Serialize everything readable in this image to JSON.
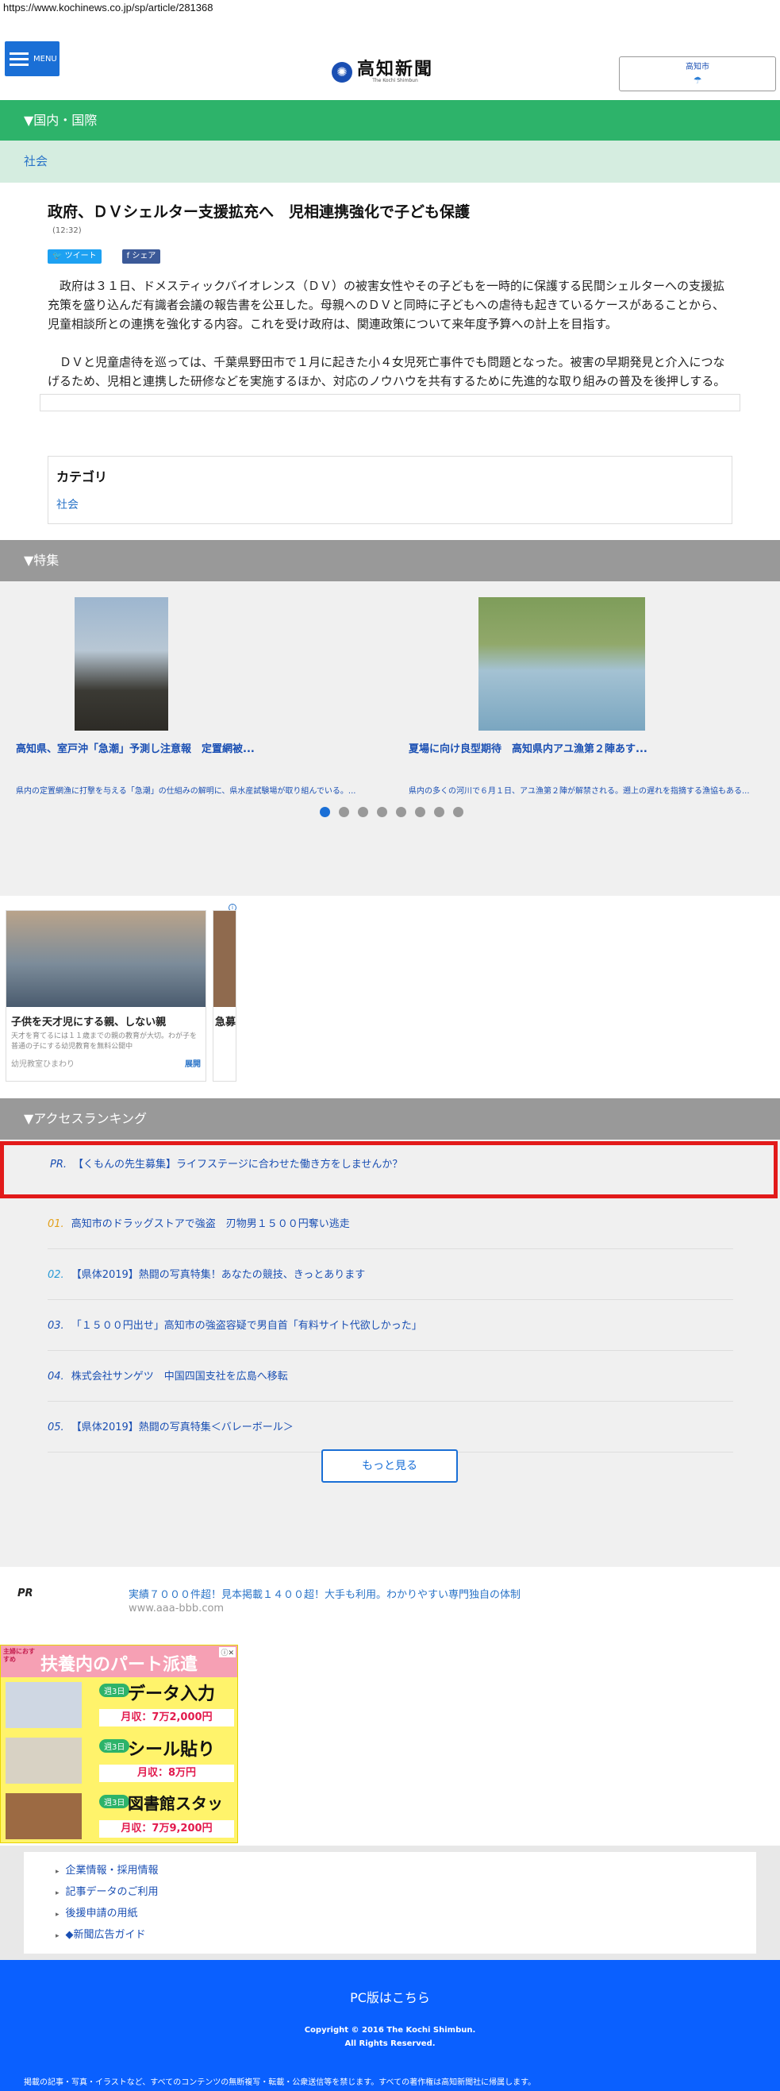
{
  "url": "https://www.kochinews.co.jp/sp/article/281368",
  "header": {
    "menu_label": "MENU",
    "logo_jp": "高知新聞",
    "logo_en": "The Kochi Shimbun",
    "weather_city": "高知市",
    "weather_icon": "sun-cloud-icon"
  },
  "section": {
    "label": "▼国内・国際",
    "subsection": "社会"
  },
  "article": {
    "title": "政府、ＤＶシェルター支援拡充へ　児相連携強化で子ども保護",
    "time": "(12:32)",
    "share_tweet": "ツイート",
    "share_fb": "シェア",
    "paragraphs": [
      "政府は３１日、ドメスティックバイオレンス（ＤＶ）の被害女性やその子どもを一時的に保護する民間シェルターへの支援拡充策を盛り込んだ有識者会議の報告書を公표した。母親へのＤＶと同時に子どもへの虐待も起きているケースがあることから、児童相談所との連携を強化する内容。これを受け政府は、関連政策について来年度予算への計上を目指す。",
      "ＤＶと児童虐待を巡っては、千葉県野田市で１月に起きた小４女児死亡事件でも問題となった。被害の早期発見と介入につなげるため、児相と連携した研修などを実施するほか、対応のノウハウを共有するために先進的な取り組みの普及を後押しする。"
    ]
  },
  "category": {
    "heading": "カテゴリ",
    "link": "社会"
  },
  "features": {
    "label": "▼特集",
    "cards": [
      {
        "title": "高知県、室戸沖「急潮」予測し注意報　定置網被...",
        "desc": "県内の定置網漁に打撃を与える「急潮」の仕組みの解明に、県水産試験場が取り組んでいる。..."
      },
      {
        "title": "夏場に向け良型期待　高知県内アユ漁第２陣あす...",
        "desc": "県内の多くの河川で６月１日、アユ漁第２陣が解禁される。遡上の遅れを指摘する漁協もある..."
      }
    ],
    "dots_total": 8,
    "dot_active": 0
  },
  "ad_card": {
    "title": "子供を天才児にする親、しない親",
    "desc": "天才を育てるには１１歳までの親の教育が大切。わが子を普通の子にする幼児教育を無料公開中",
    "source": "幼児教室ひまわり",
    "expand": "展開",
    "title2": "急募"
  },
  "ranking": {
    "label": "▼アクセスランキング",
    "pr_tag": "PR.",
    "pr_text": "【くもんの先生募集】ライフステージに合わせた働き方をしませんか？",
    "items": [
      {
        "num": "01.",
        "text": "高知市のドラッグストアで強盗　刃物男１５００円奪い逃走"
      },
      {
        "num": "02.",
        "text": "【県体2019】熱闘の写真特集！あなたの競技、きっとあります"
      },
      {
        "num": "03.",
        "text": "「１５００円出せ」高知市の強盗容疑で男自首「有料サイト代欲しかった」"
      },
      {
        "num": "04.",
        "text": "株式会社サンゲツ　中国四国支社を広島へ移転"
      },
      {
        "num": "05.",
        "text": "【県体2019】熱闘の写真特集＜バレーボール＞"
      }
    ],
    "more": "もっと見る"
  },
  "text_ad": {
    "pr": "PR",
    "title": "実績７０００件超！見本掲載１４００超！大手も利用。わかりやすい専門独自の体制",
    "url": "www.aaa-bbb.com"
  },
  "banner": {
    "small": "主婦におすすめ",
    "headline": "扶養内のパート派遣",
    "jobs": [
      {
        "tag": "週3日",
        "name": "データ入力",
        "pay": "月収：7万2,000円"
      },
      {
        "tag": "週3日",
        "name": "シール貼り",
        "pay": "月収：8万円"
      },
      {
        "tag": "週3日",
        "name": "図書館スタッフ",
        "pay": "月収：7万9,200円"
      }
    ]
  },
  "footer": {
    "links": [
      "企業情報・採用情報",
      "記事データのご利用",
      "後援申請の用紙",
      "◆新聞広告ガイド"
    ],
    "pc_link": "PC版はこちら",
    "copyright": "Copyright © 2016 The Kochi Shimbun.",
    "rights": "All Rights Reserved.",
    "notice": "掲載の記事・写真・イラストなど、すべてのコンテンツの無断複写・転載・公衆送信等を禁じます。すべての著作権は高知新聞社に帰属します。"
  }
}
